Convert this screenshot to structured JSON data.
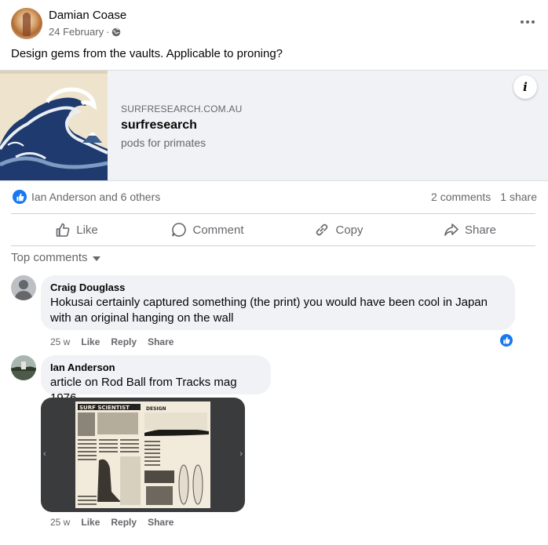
{
  "post": {
    "author": "Damian Coase",
    "date": "24 February",
    "dot": "·",
    "text": "Design gems from the vaults. Applicable to proning?"
  },
  "link_card": {
    "domain": "SURFRESEARCH.COM.AU",
    "title": "surfresearch",
    "description": "pods for primates",
    "info_label": "i"
  },
  "reactions": {
    "names": "Ian Anderson and 6 others",
    "comments": "2 comments",
    "shares": "1 share"
  },
  "actions": {
    "like": "Like",
    "comment": "Comment",
    "copy": "Copy",
    "share": "Share"
  },
  "comments_header": "Top comments",
  "comments": [
    {
      "name": "Craig Douglass",
      "text": "Hokusai certainly captured something (the print) you would have been cool in Japan with an original hanging on the wall",
      "time": "25 w",
      "like": "Like",
      "reply": "Reply",
      "share": "Share"
    },
    {
      "name": "Ian Anderson",
      "text": "article on Rod Ball from Tracks mag 1976",
      "time": "25 w",
      "like": "Like",
      "reply": "Reply",
      "share": "Share",
      "attachment": {
        "headline": "SURF SCIENTIST",
        "section": "DESIGN",
        "prev": "‹",
        "next": "›"
      }
    }
  ],
  "colors": {
    "accent": "#1877f2",
    "muted_text": "#65676b",
    "bubble": "#f0f2f5"
  }
}
